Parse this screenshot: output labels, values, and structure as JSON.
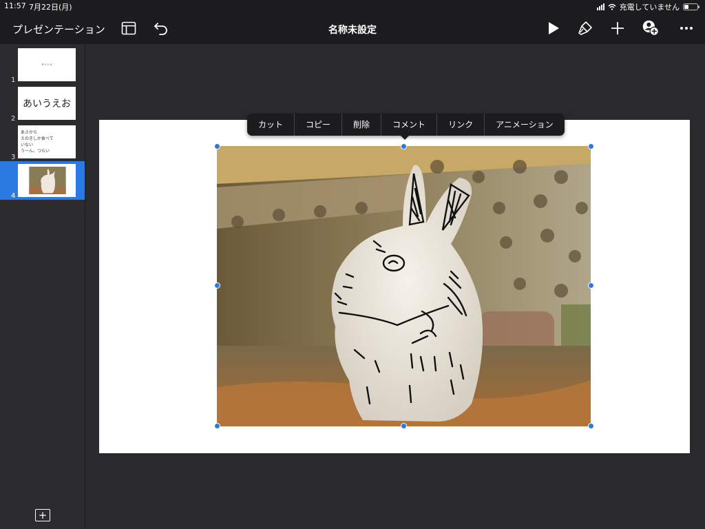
{
  "status_bar": {
    "time": "11:57",
    "date": "7月22日(月)",
    "charging_text": "充電していません"
  },
  "toolbar": {
    "app_title": "プレゼンテーション",
    "doc_title": "名称未設定"
  },
  "slides": [
    {
      "number": "1",
      "text": "タイトル"
    },
    {
      "number": "2",
      "text": "あいうえお"
    },
    {
      "number": "3",
      "lines": [
        "あさから",
        "えのきしか食べて",
        "いない",
        "うーん。つらい"
      ]
    },
    {
      "number": "4",
      "selected": true
    }
  ],
  "context_menu": [
    "カット",
    "コピー",
    "削除",
    "コメント",
    "リンク",
    "アニメーション"
  ],
  "colors": {
    "accent": "#2a7ae2",
    "toolbar": "#1c1c1e",
    "background": "#2a2a2c"
  }
}
